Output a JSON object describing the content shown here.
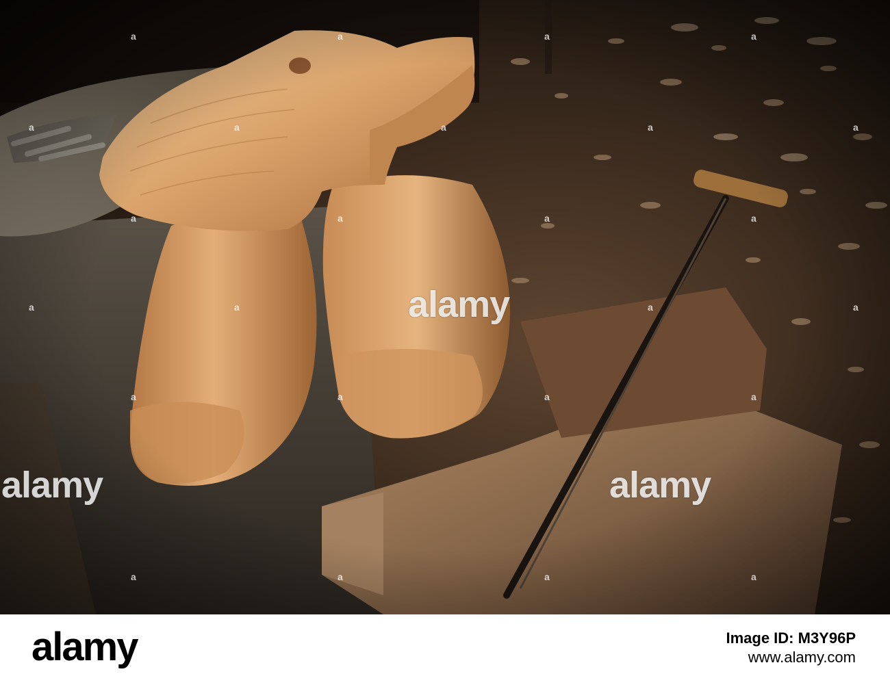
{
  "watermark": {
    "brand": "alamy",
    "mark": "a"
  },
  "footer": {
    "logo": "alamy",
    "image_id_label": "Image ID: M3Y96P",
    "url": "www.alamy.com"
  },
  "colors": {
    "background_dark": "#17120d",
    "wood_light": "#e2b07c",
    "wood_mid": "#c98e56",
    "wood_dark": "#8a5630",
    "shavings": "#b49574",
    "footer_bg": "#ffffff",
    "footer_text": "#000000"
  }
}
